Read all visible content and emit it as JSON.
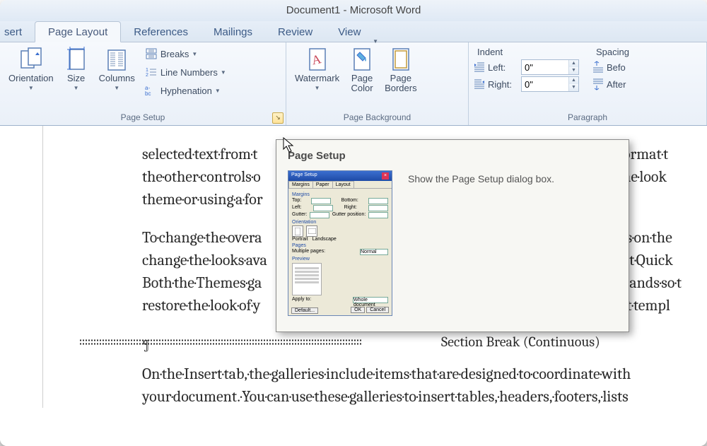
{
  "title": "Document1  -  Microsoft Word",
  "tabs": {
    "insert": "sert",
    "page_layout": "Page Layout",
    "references": "References",
    "mailings": "Mailings",
    "review": "Review",
    "view": "View"
  },
  "ribbon": {
    "page_setup": {
      "label": "Page Setup",
      "orientation": "Orientation",
      "size": "Size",
      "columns": "Columns",
      "breaks": "Breaks",
      "line_numbers": "Line Numbers",
      "hyphenation": "Hyphenation"
    },
    "page_background": {
      "label": "Page Background",
      "watermark": "Watermark",
      "page_color": "Page\nColor",
      "page_borders": "Page\nBorders"
    },
    "paragraph": {
      "label": "Paragraph",
      "indent_head": "Indent",
      "spacing_head": "Spacing",
      "left_label": "Left:",
      "right_label": "Right:",
      "left_value": "0\"",
      "right_value": "0\"",
      "before_label": "Befo",
      "after_label": "After"
    }
  },
  "tooltip": {
    "title": "Page Setup",
    "desc": "Show the Page Setup dialog box.",
    "dlg": {
      "title": "Page Setup",
      "tab1": "Margins",
      "tab2": "Paper",
      "tab3": "Layout",
      "sect_margins": "Margins",
      "top": "Top:",
      "bottom": "Bottom:",
      "left": "Left:",
      "right": "Right:",
      "gutter": "Gutter:",
      "gutter_pos": "Gutter position:",
      "sect_orient": "Orientation",
      "portrait": "Portrait",
      "landscape": "Landscape",
      "sect_pages": "Pages",
      "multi": "Multiple pages:",
      "normal": "Normal",
      "sect_preview": "Preview",
      "apply": "Apply to:",
      "whole": "Whole document",
      "default": "Default...",
      "ok": "OK",
      "cancel": "Cancel"
    }
  },
  "doc": {
    "line1": "selected·text·from·t",
    "line1b": "format·t",
    "line2": "the·other·controls·o",
    "line2b": "·the·look",
    "line3": "theme·or·using·a·for",
    "line4": "To·change·the·overa",
    "line4b": "ts·on·the",
    "line5": "change·the·looks·ava",
    "line5b": "nt·Quick",
    "line6": "Both·the·Themes·ga",
    "line6b": "ands·so·t",
    "line7": "restore·the·look·of·y",
    "line7b": "t·templ",
    "para": "¶",
    "section_break": "Section Break (Continuous)",
    "line8": "On·the·Insert·tab,·the·galleries·include·items·that·are·designed·to·coordinate·with",
    "line9": "your·document.·You·can·use·these·galleries·to·insert·tables,·headers,·footers,·lists"
  }
}
